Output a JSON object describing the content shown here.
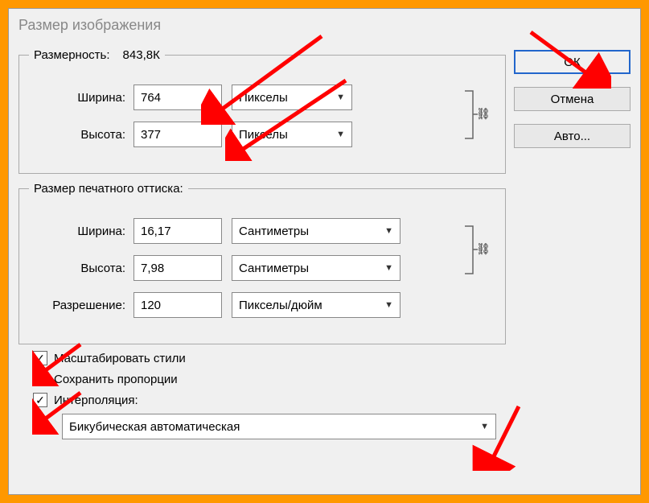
{
  "title": "Размер изображения",
  "buttons": {
    "ok": "ОК",
    "cancel": "Отмена",
    "auto": "Авто..."
  },
  "dimensions": {
    "legend": "Размерность:",
    "filesize": "843,8К",
    "widthLabel": "Ширина:",
    "widthValue": "764",
    "widthUnit": "Пикселы",
    "heightLabel": "Высота:",
    "heightValue": "377",
    "heightUnit": "Пикселы"
  },
  "print": {
    "legend": "Размер печатного оттиска:",
    "widthLabel": "Ширина:",
    "widthValue": "16,17",
    "widthUnit": "Сантиметры",
    "heightLabel": "Высота:",
    "heightValue": "7,98",
    "heightUnit": "Сантиметры",
    "resLabel": "Разрешение:",
    "resValue": "120",
    "resUnit": "Пикселы/дюйм"
  },
  "checks": {
    "scaleStyles": "Масштабировать стили",
    "constrain": "Сохранить пропорции",
    "interpolate": "Интерполяция:"
  },
  "interp": {
    "selected": "Бикубическая автоматическая"
  },
  "colors": {
    "arrow": "#ff0000"
  }
}
